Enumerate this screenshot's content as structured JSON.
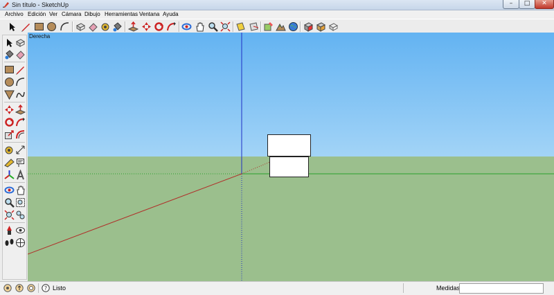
{
  "window": {
    "title": "Sin título - SketchUp",
    "minimize": "–",
    "maximize": "□",
    "close": "✕"
  },
  "menu": [
    "Archivo",
    "Edición",
    "Ver",
    "Cámara",
    "Dibujo",
    "Herramientas",
    "Ventana",
    "Ayuda"
  ],
  "toolbar_icons": [
    "select-icon",
    "pencil-line-icon",
    "rectangle-icon",
    "circle-icon",
    "arc-icon",
    "make-component-icon",
    "eraser-icon",
    "tape-measure-icon",
    "paint-bucket-icon",
    "push-pull-icon",
    "move-icon",
    "rotate-icon",
    "follow-me-icon",
    "orbit-icon",
    "pan-icon",
    "zoom-icon",
    "zoom-extents-icon",
    "previous-view-icon",
    "section-plane-icon",
    "add-location-icon",
    "toggle-terrain-icon",
    "preview-google-earth-icon",
    "get-models-icon",
    "share-model-icon",
    "share-component-icon"
  ],
  "left_toolbar_icons": [
    [
      "select-icon",
      "make-component-icon"
    ],
    [
      "paint-bucket-icon",
      "eraser-icon"
    ],
    [
      "rectangle-icon",
      "line-icon"
    ],
    [
      "circle-icon",
      "arc-icon"
    ],
    [
      "polygon-icon",
      "freehand-icon"
    ],
    [
      "move-icon",
      "push-pull-icon"
    ],
    [
      "rotate-icon",
      "follow-me-icon"
    ],
    [
      "scale-icon",
      "offset-icon"
    ],
    [
      "tape-measure-icon",
      "dimension-icon"
    ],
    [
      "protractor-icon",
      "text-icon"
    ],
    [
      "axes-icon",
      "3d-text-icon"
    ],
    [
      "orbit-icon",
      "pan-icon"
    ],
    [
      "zoom-icon",
      "zoom-window-icon"
    ],
    [
      "zoom-extents-icon",
      "previous-view-icon"
    ],
    [
      "position-camera-icon",
      "look-around-icon"
    ],
    [
      "walk-icon",
      "section-plane-icon"
    ]
  ],
  "viewport": {
    "scene_name": "Derecha"
  },
  "colors": {
    "sky_top": "#63b3f2",
    "sky_bottom": "#cde8fa",
    "ground": "#9bbf8d",
    "red_axis": "#b0302a",
    "green_axis": "#2aa02a",
    "blue_axis": "#1f2fc4"
  },
  "status": {
    "text": "Listo",
    "measure_label": "Medidas",
    "measure_value": ""
  }
}
